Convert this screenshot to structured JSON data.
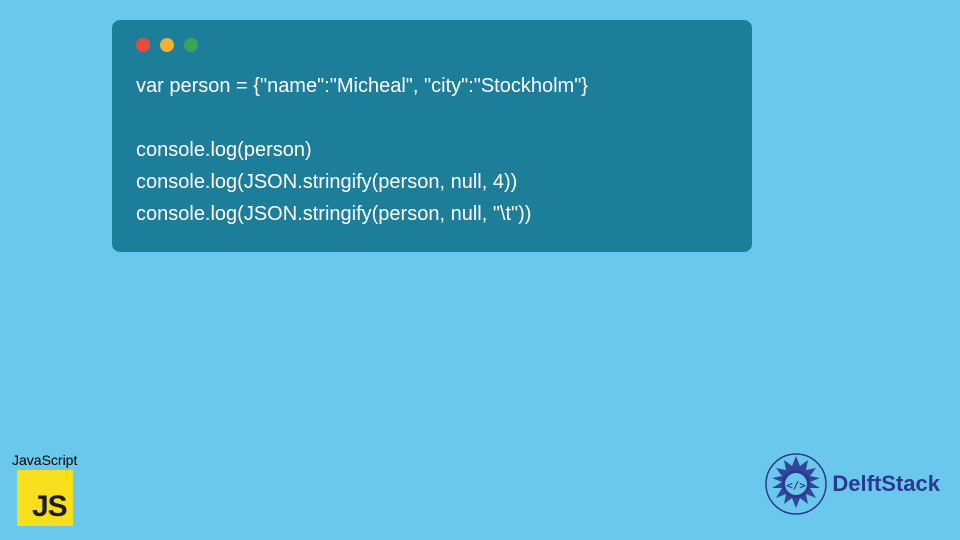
{
  "code": {
    "line1": "var person = {\"name\":\"Micheal\", \"city\":\"Stockholm\"}",
    "line2": "",
    "line3": "console.log(person)",
    "line4": "console.log(JSON.stringify(person, null, 4))",
    "line5": "console.log(JSON.stringify(person, null, \"\\t\"))"
  },
  "js_badge": {
    "label": "JavaScript",
    "logo_text": "JS"
  },
  "brand": {
    "name": "DelftStack"
  },
  "colors": {
    "page_bg": "#6ac8ed",
    "window_bg": "#1d7e9a",
    "js_yellow": "#f7df1e",
    "brand_blue": "#2b3990"
  }
}
